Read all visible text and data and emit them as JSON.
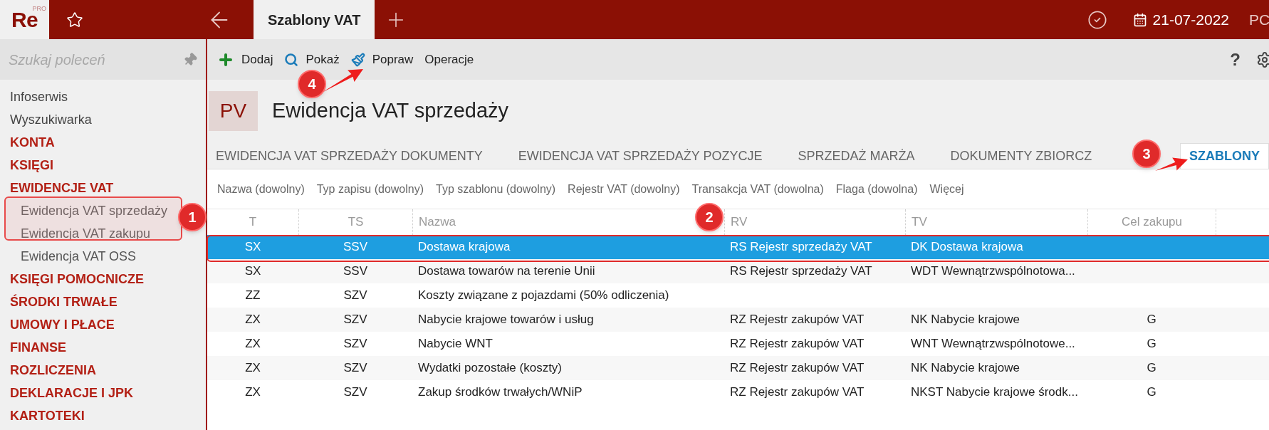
{
  "logo": {
    "text": "Re",
    "badge": "PRO"
  },
  "top_tabs": [
    {
      "label": "Szablony VAT",
      "selected": true
    }
  ],
  "date": "21-07-2022",
  "user": "PC",
  "sidebar": {
    "search_placeholder": "Szukaj poleceń",
    "items": [
      {
        "kind": "link",
        "label": "Infoserwis"
      },
      {
        "kind": "link",
        "label": "Wyszukiwarka"
      },
      {
        "kind": "section",
        "label": "KONTA"
      },
      {
        "kind": "section",
        "label": "KSIĘGI"
      },
      {
        "kind": "section",
        "label": "EWIDENCJE VAT",
        "children": [
          {
            "label": "Ewidencja VAT sprzedaży"
          },
          {
            "label": "Ewidencja VAT zakupu"
          },
          {
            "label": "Ewidencja VAT OSS"
          }
        ]
      },
      {
        "kind": "section",
        "label": "KSIĘGI POMOCNICZE"
      },
      {
        "kind": "section",
        "label": "ŚRODKI TRWAŁE"
      },
      {
        "kind": "section",
        "label": "UMOWY I PŁACE"
      },
      {
        "kind": "section",
        "label": "FINANSE"
      },
      {
        "kind": "section",
        "label": "ROZLICZENIA"
      },
      {
        "kind": "section",
        "label": "DEKLARACJE I JPK"
      },
      {
        "kind": "section",
        "label": "KARTOTEKI"
      }
    ]
  },
  "toolbar": [
    {
      "kind": "add",
      "label": "Dodaj"
    },
    {
      "kind": "show",
      "label": "Pokaż"
    },
    {
      "kind": "edit",
      "label": "Popraw"
    },
    {
      "kind": "plain",
      "label": "Operacje"
    }
  ],
  "help": "?",
  "page": {
    "badge": "PV",
    "title": "Ewidencja VAT sprzedaży"
  },
  "tabs": [
    {
      "label": "EWIDENCJA VAT SPRZEDAŻY DOKUMENTY",
      "selected": false
    },
    {
      "label": "EWIDENCJA VAT SPRZEDAŻY POZYCJE",
      "selected": false
    },
    {
      "label": "SPRZEDAŻ MARŻA",
      "selected": false
    },
    {
      "label": "DOKUMENTY ZBIORCZ",
      "selected": false
    },
    {
      "label": "SZABLONY",
      "selected": true
    }
  ],
  "filters": [
    "Nazwa (dowolny)",
    "Typ zapisu (dowolny)",
    "Typ szablonu (dowolny)",
    "Rejestr VAT (dowolny)",
    "Transakcja VAT (dowolna)",
    "Flaga (dowolna)",
    "Więcej"
  ],
  "table": {
    "columns": [
      "T",
      "TS",
      "Nazwa",
      "RV",
      "TV",
      "Cel zakupu"
    ],
    "rows": [
      {
        "selected": true,
        "cells": [
          "SX",
          "SSV",
          "Dostawa krajowa",
          "RS Rejestr sprzedaży VAT",
          "DK Dostawa krajowa",
          ""
        ]
      },
      {
        "selected": false,
        "cells": [
          "SX",
          "SSV",
          "Dostawa towarów na terenie Unii",
          "RS Rejestr sprzedaży VAT",
          "WDT Wewnątrzwspólnotowa...",
          ""
        ]
      },
      {
        "selected": false,
        "cells": [
          "ZZ",
          "SZV",
          "Koszty związane z pojazdami (50% odliczenia)",
          "",
          "",
          ""
        ]
      },
      {
        "selected": false,
        "cells": [
          "ZX",
          "SZV",
          "Nabycie krajowe towarów i usług",
          "RZ Rejestr zakupów VAT",
          "NK Nabycie krajowe",
          "G"
        ]
      },
      {
        "selected": false,
        "cells": [
          "ZX",
          "SZV",
          "Nabycie WNT",
          "RZ Rejestr zakupów VAT",
          "WNT Wewnątrzwspólnotowe...",
          "G"
        ]
      },
      {
        "selected": false,
        "cells": [
          "ZX",
          "SZV",
          "Wydatki pozostałe (koszty)",
          "RZ Rejestr zakupów VAT",
          "NK Nabycie krajowe",
          "G"
        ]
      },
      {
        "selected": false,
        "cells": [
          "ZX",
          "SZV",
          "Zakup środków trwałych/WNiP",
          "RZ Rejestr zakupów VAT",
          "NKST Nabycie krajowe środk...",
          "G"
        ]
      }
    ]
  },
  "annotations": [
    "1",
    "2",
    "3",
    "4"
  ]
}
